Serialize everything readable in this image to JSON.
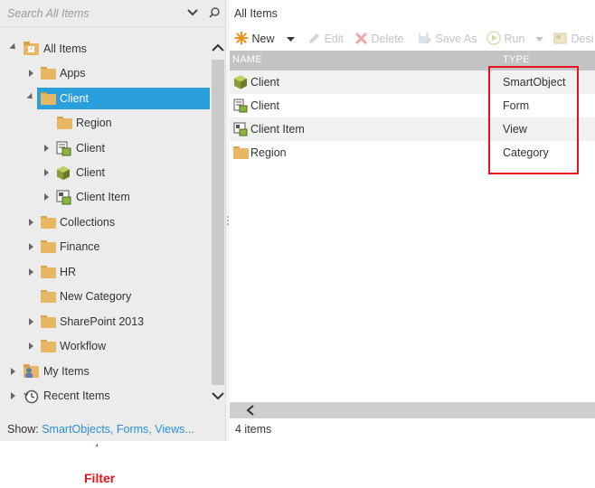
{
  "search": {
    "placeholder": "Search All Items"
  },
  "tree": [
    {
      "label": "All Items"
    },
    {
      "label": "Apps"
    },
    {
      "label": "Client"
    },
    {
      "label": "Region"
    },
    {
      "label": "Client"
    },
    {
      "label": "Client"
    },
    {
      "label": "Client Item"
    },
    {
      "label": "Collections"
    },
    {
      "label": "Finance"
    },
    {
      "label": "HR"
    },
    {
      "label": "New Category"
    },
    {
      "label": "SharePoint 2013"
    },
    {
      "label": "Workflow"
    },
    {
      "label": "My Items"
    },
    {
      "label": "Recent Items"
    }
  ],
  "show": {
    "prefix": "Show: ",
    "link": "SmartObjects, Forms, Views..."
  },
  "right": {
    "title": "All Items",
    "toolbar": {
      "new": "New",
      "edit": "Edit",
      "delete": "Delete",
      "save_as": "Save As",
      "run": "Run",
      "design": "Desi"
    },
    "columns": {
      "name": "NAME",
      "type": "TYPE"
    },
    "rows": [
      {
        "name": "Client",
        "type": "SmartObject"
      },
      {
        "name": "Client",
        "type": "Form"
      },
      {
        "name": "Client Item",
        "type": "View"
      },
      {
        "name": "Region",
        "type": "Category"
      }
    ],
    "count": "4 items"
  },
  "annotation": {
    "label": "Filter"
  },
  "colors": {
    "accent": "#2a9fdb",
    "link": "#2a8fd4",
    "highlight": "#e3141b",
    "folder": "#e8b763"
  }
}
